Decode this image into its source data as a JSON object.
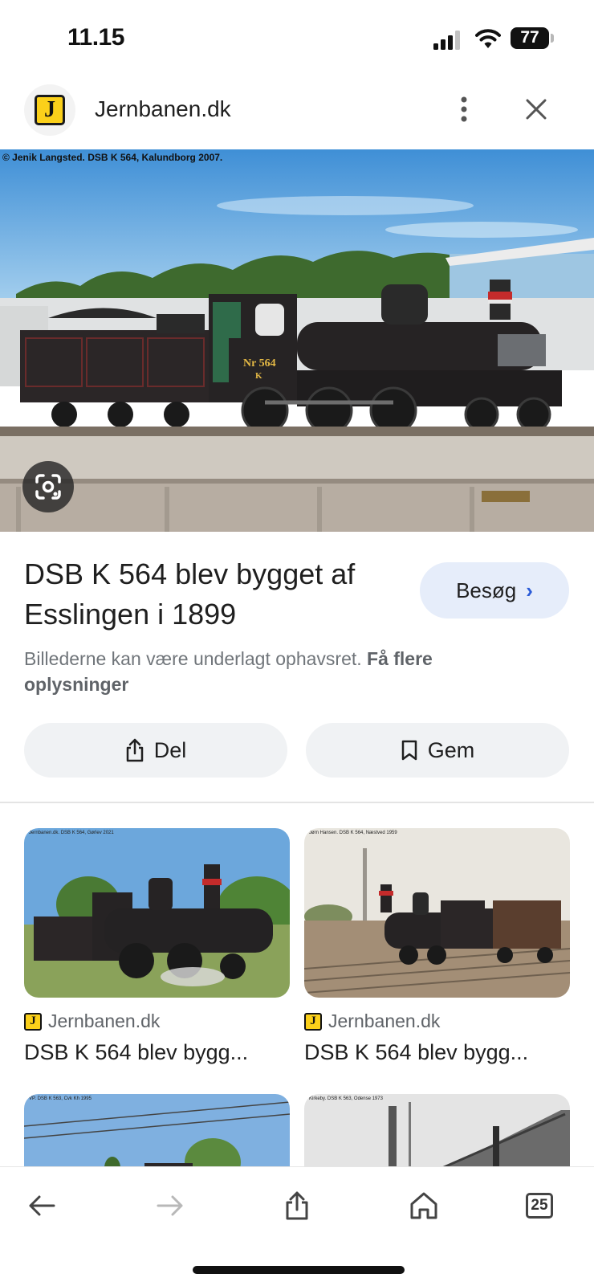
{
  "status_bar": {
    "time": "11.15",
    "battery": "77"
  },
  "header": {
    "site_name": "Jernbanen.dk",
    "logo_letter": "J",
    "more_icon": "more-vertical-icon",
    "close_icon": "close-icon"
  },
  "hero": {
    "credit": "© Jenik Langsted. DSB K 564, Kalundborg 2007.",
    "plate_line1": "Nr 564",
    "plate_line2": "K",
    "lens_icon": "google-lens-icon"
  },
  "result": {
    "title": "DSB K 564 blev bygget af Esslingen i 1899",
    "visit_label": "Besøg",
    "copyright_text": "Billederne kan være underlagt ophavsret.",
    "copyright_link": "Få flere oplysninger"
  },
  "actions": {
    "share_label": "Del",
    "save_label": "Gem"
  },
  "related": [
    {
      "caption": "Jernbanen.dk. DSB K 564, Gørlev 2021",
      "source": "Jernbanen.dk",
      "title": "DSB K 564 blev bygg..."
    },
    {
      "caption": "Jørn Hansen. DSB K 564, Næstved 1959",
      "source": "Jernbanen.dk",
      "title": "DSB K 564 blev bygg..."
    },
    {
      "caption": "VP. DSB K 563, Cvk Kh 1995"
    },
    {
      "caption": "Kirkeby. DSB K 563, Odense 1973"
    }
  ],
  "toolbar": {
    "tabs_count": "25"
  },
  "colors": {
    "accent": "#2a5bd7",
    "visit_bg": "#e6edfa",
    "button_bg": "#f0f2f4",
    "logo_yellow": "#fbd01a"
  }
}
